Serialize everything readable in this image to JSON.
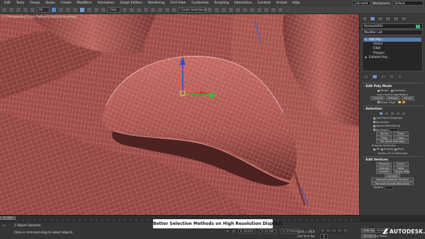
{
  "menubar": {
    "items": [
      "Edit",
      "Tools",
      "Group",
      "Views",
      "Create",
      "Modifiers",
      "Animation",
      "Graph Editors",
      "Rendering",
      "Civil View",
      "Customize",
      "Scripting",
      "Interactive",
      "Content",
      "Arnold",
      "Help"
    ],
    "user": "johnsafat",
    "workspace_label": "Workspaces:",
    "workspace_value": "Default"
  },
  "toolbar": {
    "filter_value": "All",
    "view_value": "View",
    "selection_set_placeholder": "Create Selection Set"
  },
  "viewport": {
    "label": "[+] [Perspective] [User Defined] [Default Shading]",
    "gizmo_colors": {
      "x": "#e03030",
      "y": "#30c030",
      "z": "#2050e0"
    }
  },
  "command_panel": {
    "object_name": "Stomach001",
    "modifier_list_label": "Modifier List",
    "stack": [
      {
        "label": "Edit Poly",
        "selected": true
      },
      {
        "label": "Vertex",
        "selected": false
      },
      {
        "label": "Edge",
        "selected": false
      },
      {
        "label": "Polygon",
        "selected": false
      },
      {
        "label": "Editable Poly",
        "selected": false
      }
    ],
    "rollouts": {
      "edit_poly_mode": {
        "title": "Edit Poly Mode",
        "model": "Model",
        "animate": "Animate",
        "frame": "<no current operation>",
        "commit": "Commit",
        "settings": "Settings",
        "cancel": "Cancel",
        "show_cage": "Show Cage"
      },
      "selection": {
        "title": "Selection",
        "use_stack": "Use Stack Selection",
        "by_vertex": "By Vertex",
        "ignore_backfacing": "Ignore Backfacing",
        "by_angle": "By Angle:",
        "shrink": "Shrink",
        "grow": "Grow",
        "ring": "Ring",
        "loop": "Loop",
        "get_stack": "Get Stack Selection",
        "preview": "Preview Selection",
        "off": "Off",
        "subobj": "SubObj",
        "multi": "Multi",
        "status": "Vertex 22,14 Selected"
      },
      "edit_vertices": {
        "title": "Edit Vertices",
        "remove": "Remove",
        "break": "Break",
        "extrude": "Extrude",
        "weld": "Weld",
        "chamfer": "Chamfer",
        "target_weld": "Target Weld",
        "connect": "Connect",
        "remove_isolated": "Remove Isolated Vertices",
        "remove_unused": "Remove Unused Map Verts",
        "weight": "Weight:"
      }
    }
  },
  "timeline": {
    "slider_label": "0 / 100"
  },
  "statusbar": {
    "selection": "1 Object Selected",
    "prompt": "Click or click-and-drag to select objects",
    "x": "X: 35,291",
    "y": "Y: 31,349",
    "z": "Z: 47,5mm",
    "grid": "Grid = 10,0",
    "add_time_tag": "Add Time Tag",
    "auto_key": "Auto Key",
    "set_key": "Set Key",
    "selected": "Selected",
    "key_filters": "Key Filters...",
    "frame": "0"
  },
  "caption": "Better Selection Methods on High Resolution Displays",
  "brand": "AUTODESK."
}
